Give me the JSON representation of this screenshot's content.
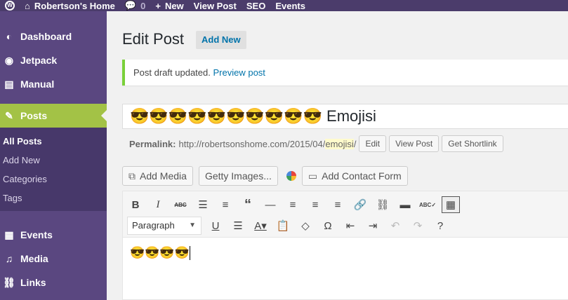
{
  "adminbar": {
    "site_name": "Robertson's Home",
    "comments_count": "0",
    "new_label": "New",
    "view_post_label": "View Post",
    "seo_label": "SEO",
    "events_label": "Events"
  },
  "sidebar": {
    "items": [
      {
        "label": "Dashboard",
        "icon": "dashboard-icon"
      },
      {
        "label": "Jetpack",
        "icon": "jetpack-icon"
      },
      {
        "label": "Manual",
        "icon": "manual-icon"
      },
      {
        "label": "Posts",
        "icon": "pin-icon"
      },
      {
        "label": "Events",
        "icon": "calendar-icon"
      },
      {
        "label": "Media",
        "icon": "media-icon"
      },
      {
        "label": "Links",
        "icon": "link-icon"
      }
    ],
    "submenu": [
      "All Posts",
      "Add New",
      "Categories",
      "Tags"
    ]
  },
  "page": {
    "title": "Edit Post",
    "add_new_label": "Add New"
  },
  "notice": {
    "text": "Post draft updated.",
    "link": "Preview post"
  },
  "post": {
    "title": "😎😎😎😎😎😎😎😎😎😎 Emojisi",
    "permalink_label": "Permalink:",
    "permalink_base": "http://robertsonshome.com/2015/04/",
    "permalink_slug": "emojisi",
    "permalink_trailing": "/",
    "edit_label": "Edit",
    "view_post_label": "View Post",
    "shortlink_label": "Get Shortlink"
  },
  "media_buttons": {
    "add_media": "Add Media",
    "getty": "Getty Images...",
    "contact_form": "Add Contact Form"
  },
  "editor": {
    "format_value": "Paragraph",
    "content": "😎😎😎😎"
  },
  "colors": {
    "adminbar": "#4b3c6b",
    "sidebar": "#5a4780",
    "active_menu": "#a3c246",
    "notice_border": "#7ad03a",
    "link": "#0073aa"
  }
}
